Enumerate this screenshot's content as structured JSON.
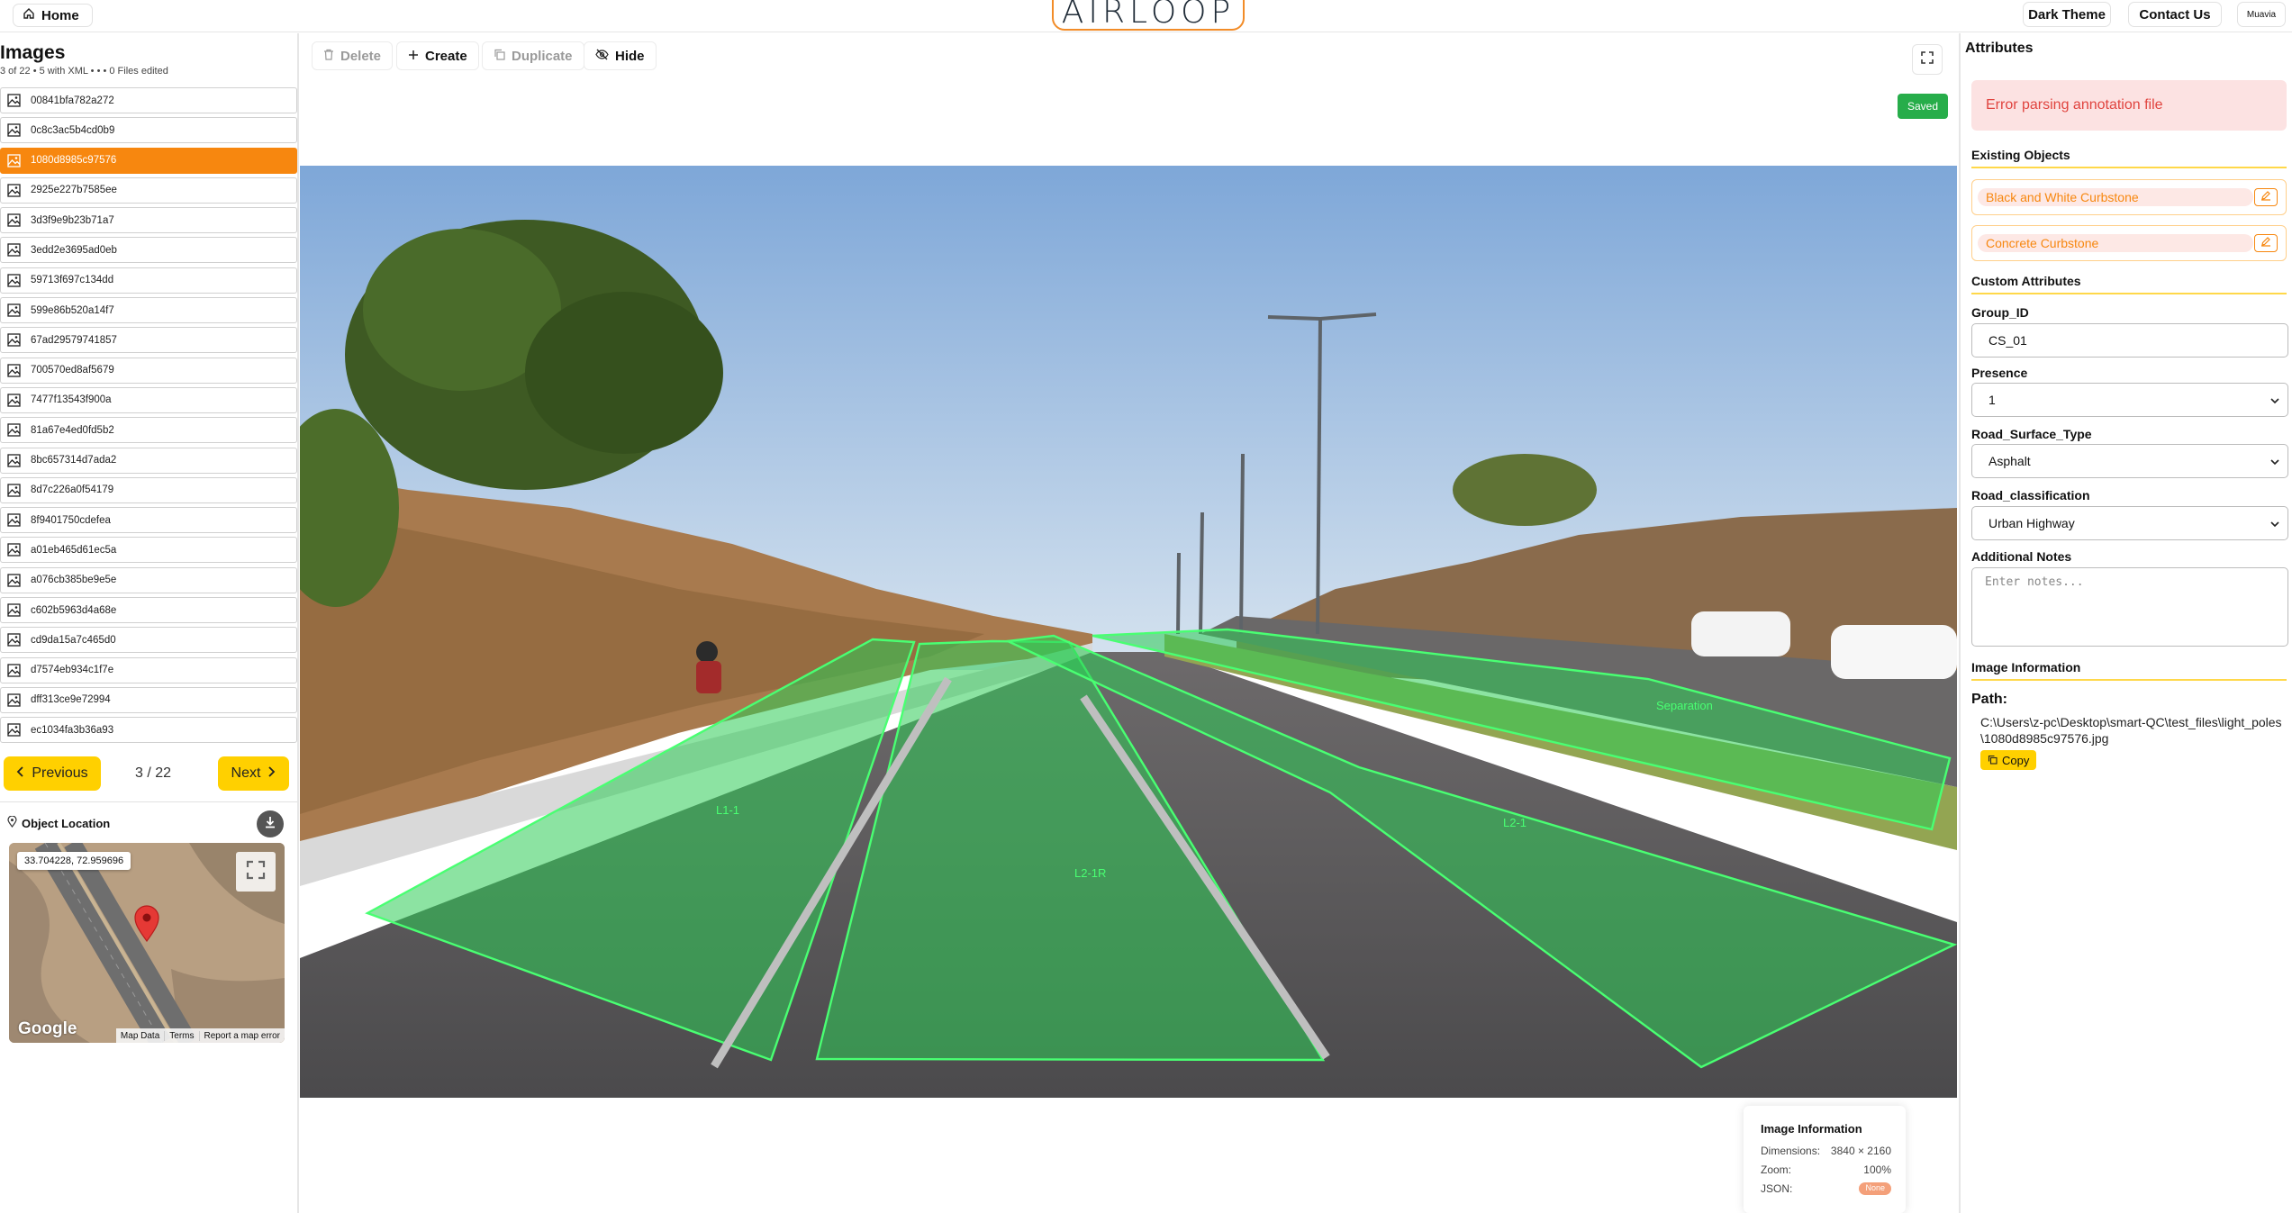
{
  "topbar": {
    "home_label": "Home",
    "logo_text": "AIRLOOP",
    "dark_theme_label": "Dark Theme",
    "contact_label": "Contact Us",
    "user_label": "Muavia"
  },
  "sidebar": {
    "title": "Images",
    "subtitle": "3 of 22 • 5 with XML • • • 0 Files edited",
    "files": [
      {
        "name": "00841bfa782a272"
      },
      {
        "name": "0c8c3ac5b4cd0b9"
      },
      {
        "name": "1080d8985c97576"
      },
      {
        "name": "2925e227b7585ee"
      },
      {
        "name": "3d3f9e9b23b71a7"
      },
      {
        "name": "3edd2e3695ad0eb"
      },
      {
        "name": "59713f697c134dd"
      },
      {
        "name": "599e86b520a14f7"
      },
      {
        "name": "67ad29579741857"
      },
      {
        "name": "700570ed8af5679"
      },
      {
        "name": "7477f13543f900a"
      },
      {
        "name": "81a67e4ed0fd5b2"
      },
      {
        "name": "8bc657314d7ada2"
      },
      {
        "name": "8d7c226a0f54179"
      },
      {
        "name": "8f9401750cdefea"
      },
      {
        "name": "a01eb465d61ec5a"
      },
      {
        "name": "a076cb385be9e5e"
      },
      {
        "name": "c602b5963d4a68e"
      },
      {
        "name": "cd9da15a7c465d0"
      },
      {
        "name": "d7574eb934c1f7e"
      },
      {
        "name": "dff313ce9e72994"
      },
      {
        "name": "ec1034fa3b36a93"
      }
    ],
    "active_index": 2,
    "prev_label": "Previous",
    "next_label": "Next",
    "page_indicator": "3 / 22",
    "location_label": "Object Location",
    "map": {
      "coordinates": "33.704228, 72.959696",
      "provider": "Google",
      "footer": [
        "Map Data",
        "Terms",
        "Report a map error"
      ]
    }
  },
  "toolbar": {
    "delete_label": "Delete",
    "create_label": "Create",
    "duplicate_label": "Duplicate",
    "hide_label": "Hide",
    "saved_label": "Saved"
  },
  "annotations": [
    {
      "label": "L1-1"
    },
    {
      "label": "L2-1R"
    },
    {
      "label": "L2-1"
    },
    {
      "label": "Separation"
    }
  ],
  "image_info": {
    "title": "Image Information",
    "dimensions_label": "Dimensions:",
    "dimensions_value": "3840 × 2160",
    "zoom_label": "Zoom:",
    "zoom_value": "100%",
    "json_label": "JSON:",
    "json_value": "None"
  },
  "attributes": {
    "title": "Attributes",
    "error": "Error parsing annotation file",
    "existing_objects_label": "Existing Objects",
    "objects": [
      {
        "label": "Black and White Curbstone"
      },
      {
        "label": "Concrete Curbstone"
      }
    ],
    "custom_attributes_label": "Custom Attributes",
    "group_id_label": "Group_ID",
    "group_id_value": "CS_01",
    "presence_label": "Presence",
    "presence_value": "1",
    "road_surface_label": "Road_Surface_Type",
    "road_surface_value": "Asphalt",
    "road_class_label": "Road_classification",
    "road_class_value": "Urban Highway",
    "notes_label": "Additional Notes",
    "notes_placeholder": "Enter notes...",
    "image_info_label": "Image Information",
    "path_label": "Path:",
    "path_value": "C:\\Users\\z-pc\\Desktop\\smart-QC\\test_files\\light_poles\\1080d8985c97576.jpg",
    "copy_label": "Copy"
  },
  "colors": {
    "accent_orange": "#f7870f",
    "accent_yellow": "#ffd000",
    "saved_green": "#27ad4a",
    "annotation_green": "#39e75f",
    "error_bg": "#fce2e2",
    "error_text": "#e0443f"
  }
}
